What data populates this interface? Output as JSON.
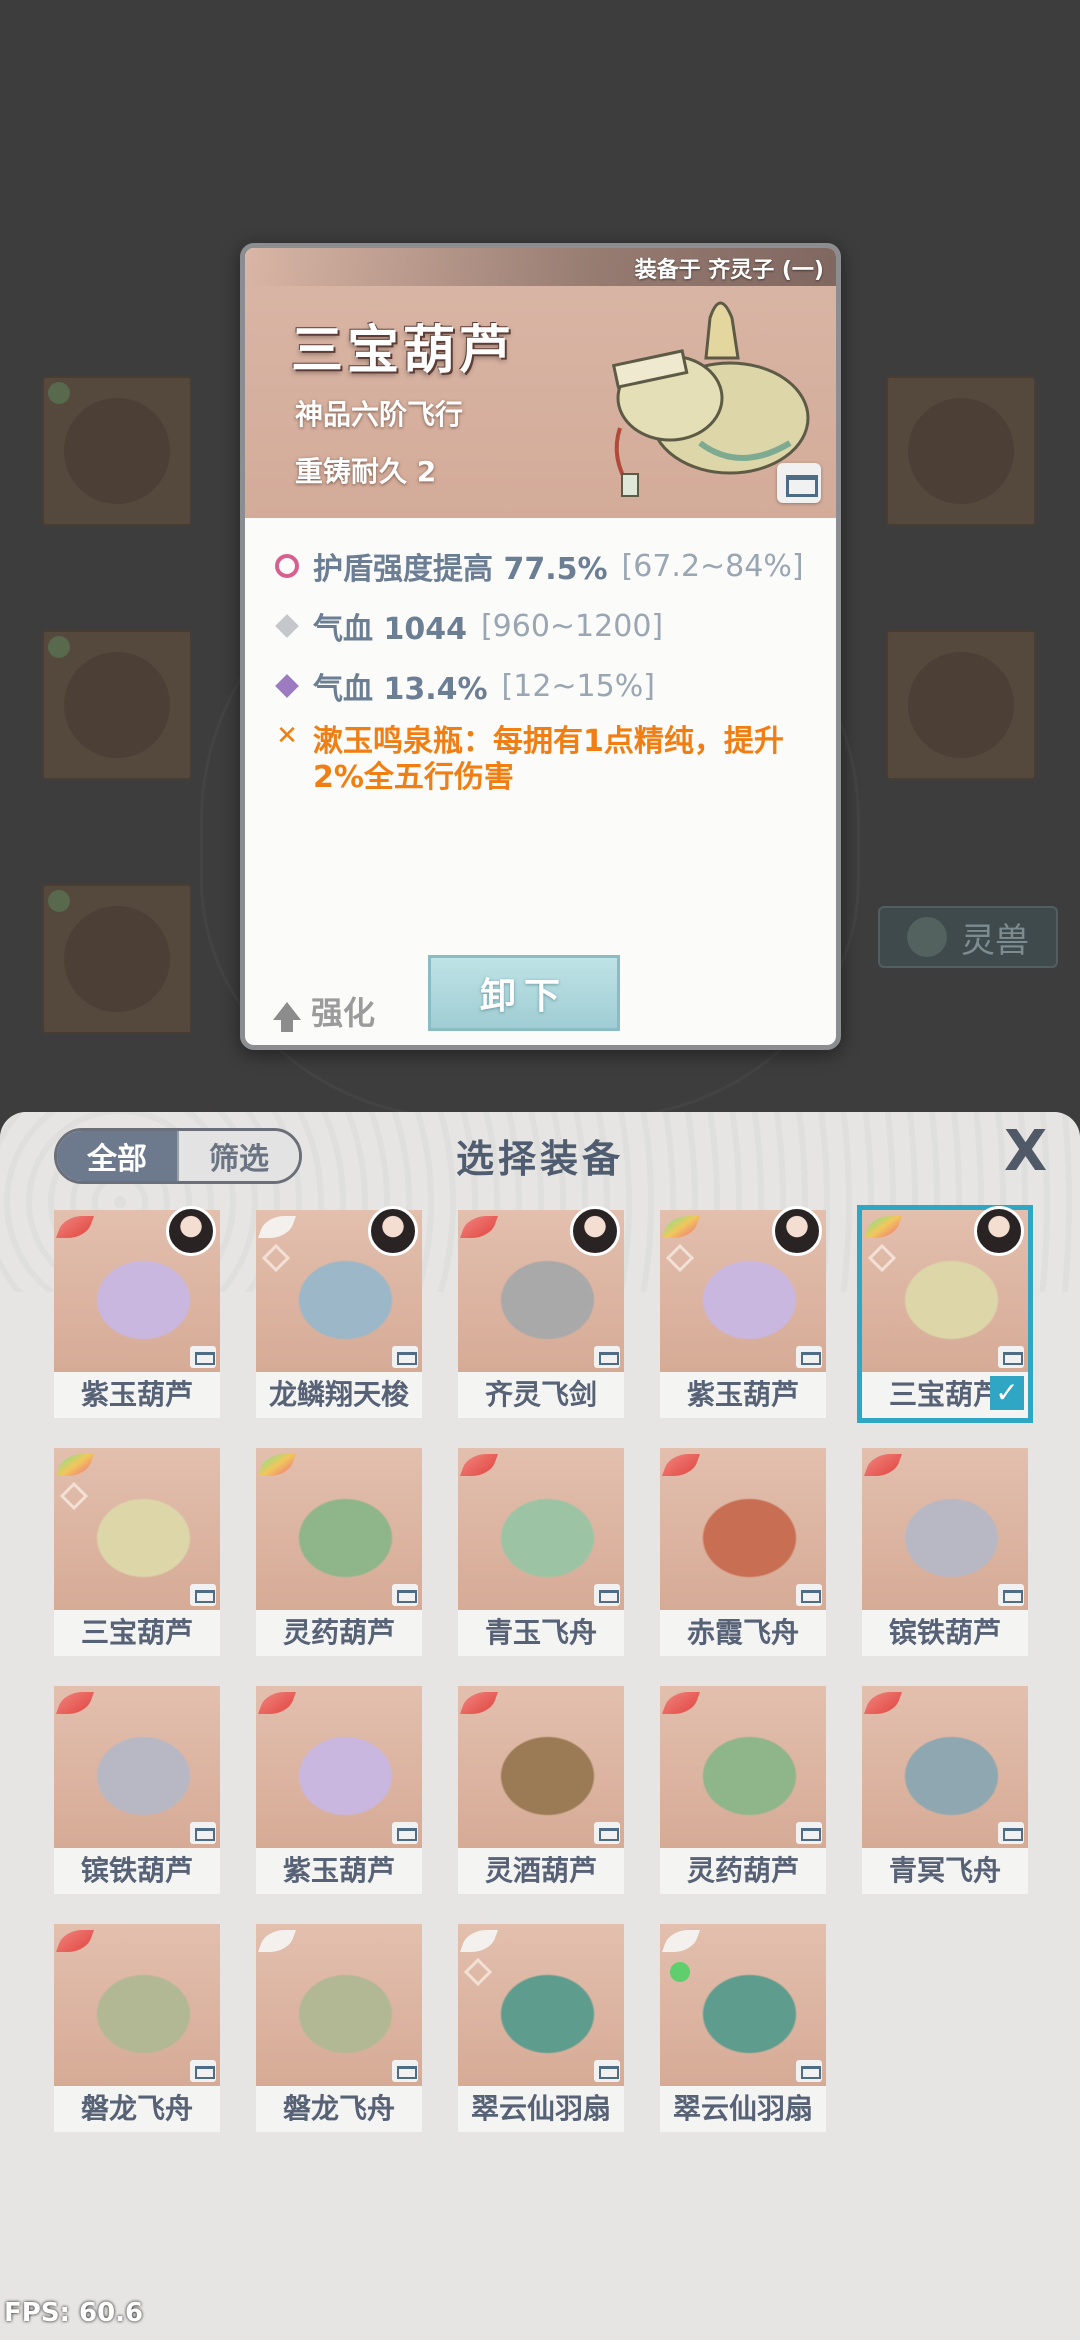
{
  "detail": {
    "equipped_to": "装备于 齐灵子 (一)",
    "name": "三宝葫芦",
    "grade": "神品六阶飞行",
    "recast": "重铸耐久 2",
    "stats": [
      {
        "label": "护盾强度提高 77.5%",
        "range": "[67.2~84%]"
      },
      {
        "label": "气血 1044",
        "range": "[960~1200]"
      },
      {
        "label": "气血 13.4%",
        "range": "[12~15%]"
      },
      {
        "label": "漱玉鸣泉瓶：每拥有1点精纯，提升2%全五行伤害",
        "range": ""
      }
    ],
    "enhance_label": "强化",
    "unequip_label": "卸下"
  },
  "background": {
    "spirit_beast_tab": "灵兽"
  },
  "panel": {
    "title": "选择装备",
    "tabs": [
      "全部",
      "筛选"
    ],
    "close_label": "X",
    "items": [
      {
        "name": "紫玉葫芦",
        "wing": "red",
        "avatar": true,
        "rune": false,
        "selected": false
      },
      {
        "name": "龙鳞翔天梭",
        "wing": "white",
        "avatar": true,
        "rune": true,
        "selected": false
      },
      {
        "name": "齐灵飞剑",
        "wing": "red",
        "avatar": true,
        "rune": false,
        "selected": false
      },
      {
        "name": "紫玉葫芦",
        "wing": "rainbow",
        "avatar": true,
        "rune": true,
        "selected": false
      },
      {
        "name": "三宝葫芦",
        "wing": "rainbow",
        "avatar": true,
        "rune": true,
        "selected": true
      },
      {
        "name": "三宝葫芦",
        "wing": "rainbow",
        "avatar": false,
        "rune": true,
        "selected": false
      },
      {
        "name": "灵药葫芦",
        "wing": "rainbow",
        "avatar": false,
        "rune": false,
        "selected": false
      },
      {
        "name": "青玉飞舟",
        "wing": "red",
        "avatar": false,
        "rune": false,
        "selected": false
      },
      {
        "name": "赤霞飞舟",
        "wing": "red",
        "avatar": false,
        "rune": false,
        "selected": false
      },
      {
        "name": "镔铁葫芦",
        "wing": "red",
        "avatar": false,
        "rune": false,
        "selected": false
      },
      {
        "name": "镔铁葫芦",
        "wing": "red",
        "avatar": false,
        "rune": false,
        "selected": false
      },
      {
        "name": "紫玉葫芦",
        "wing": "red",
        "avatar": false,
        "rune": false,
        "selected": false
      },
      {
        "name": "灵酒葫芦",
        "wing": "red",
        "avatar": false,
        "rune": false,
        "selected": false
      },
      {
        "name": "灵药葫芦",
        "wing": "red",
        "avatar": false,
        "rune": false,
        "selected": false
      },
      {
        "name": "青冥飞舟",
        "wing": "red",
        "avatar": false,
        "rune": false,
        "selected": false
      },
      {
        "name": "磐龙飞舟",
        "wing": "red",
        "avatar": false,
        "rune": false,
        "selected": false
      },
      {
        "name": "磐龙飞舟",
        "wing": "white",
        "avatar": false,
        "rune": false,
        "selected": false
      },
      {
        "name": "翠云仙羽扇",
        "wing": "white",
        "avatar": false,
        "rune": true,
        "selected": false
      },
      {
        "name": "翠云仙羽扇",
        "wing": "white",
        "avatar": false,
        "rune": "green",
        "selected": false
      }
    ]
  },
  "fps": "FPS: 60.6"
}
